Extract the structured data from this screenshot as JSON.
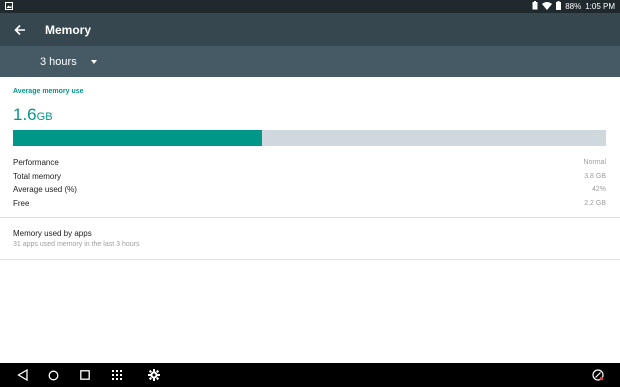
{
  "status_bar": {
    "battery_percent": "88%",
    "time": "1:05 PM",
    "icons": [
      "image-notification-icon",
      "battery-saver-icon",
      "wifi-icon",
      "battery-icon"
    ]
  },
  "app_bar": {
    "title": "Memory",
    "back_icon": "arrow-back-icon"
  },
  "filter": {
    "selected": "3 hours"
  },
  "summary": {
    "heading": "Average memory use",
    "value": "1.6",
    "unit": "GB",
    "usage_fraction": 0.42,
    "fill_color": "#009688",
    "track_color": "#cfd8dc"
  },
  "stats": [
    {
      "label": "Performance",
      "value": "Normal"
    },
    {
      "label": "Total memory",
      "value": "3.8 GB"
    },
    {
      "label": "Average used (%)",
      "value": "42%"
    },
    {
      "label": "Free",
      "value": "2.2 GB"
    }
  ],
  "apps_item": {
    "title": "Memory used by apps",
    "subtitle": "31 apps used memory in the last 3 hours"
  },
  "nav_bar": {
    "buttons": [
      "back-nav-icon",
      "home-nav-icon",
      "recents-nav-icon",
      "apps-grid-icon",
      "settings-gear-icon",
      "screen-record-icon"
    ]
  },
  "colors": {
    "accent": "#009688",
    "app_bar": "#37474f",
    "filter_bar": "#455a64"
  }
}
